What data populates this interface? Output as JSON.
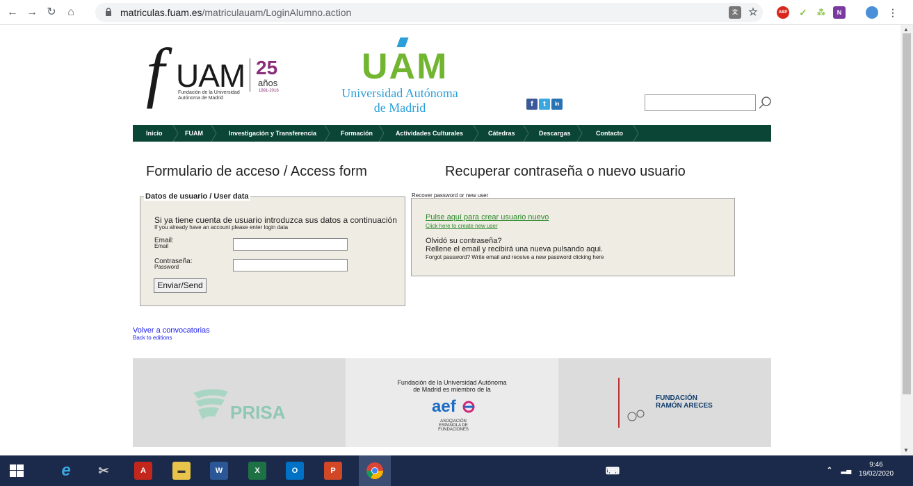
{
  "browser": {
    "url_host": "matriculas.fuam.es",
    "url_path": "/matriculauam/LoginAlumno.action",
    "back_icon": "arrow-left-icon",
    "forward_icon": "arrow-right-icon",
    "reload_icon": "reload-icon",
    "home_icon": "home-icon"
  },
  "header": {
    "fuam_letter": "f",
    "fuam_name": "UAM",
    "fuam_subtitle": "Fundación de la Universidad Autónoma de Madrid",
    "anniversary_number": "25",
    "anniversary_word": "años",
    "anniversary_years": "1991-2016",
    "uam_acronym": "UAM",
    "uam_name_line1": "Universidad Autónoma",
    "uam_name_line2": "de Madrid",
    "social": [
      "f",
      "t",
      "in"
    ]
  },
  "nav": {
    "items": [
      "Inicio",
      "FUAM",
      "Investigación y Transferencia",
      "Formación",
      "Actividades Culturales",
      "Cátedras",
      "Descargas",
      "Contacto"
    ]
  },
  "login": {
    "heading": "Formulario de acceso / Access form",
    "legend": "Datos de usuario / User data",
    "intro": "Si ya tiene cuenta de usuario introduzca sus datos a continuación",
    "intro_en": "If you already have an account please enter login data",
    "email_label": "Email:",
    "email_label_en": "Email",
    "email_value": "",
    "password_label": "Contraseña:",
    "password_label_en": "Password",
    "password_value": "",
    "submit_label": "Enviar/Send"
  },
  "recover": {
    "heading": "Recuperar contraseña o nuevo usuario",
    "subtitle_en": "Recover password or new user",
    "new_user_link": "Pulse aquí para crear usuario nuevo",
    "new_user_link_en": "Click here to create new user",
    "forgot_line1": "Olvidó su contraseña?",
    "forgot_line2": "Rellene el email y recibirá una nueva pulsando aqui.",
    "forgot_line3": "Forgot password? Write email and receive a new password clicking here"
  },
  "back": {
    "label": "Volver a convocatorias",
    "label_en": "Back to editions"
  },
  "sponsors": {
    "prisa": "PRISA",
    "aef_text_line1": "Fundación de la Universidad Autónoma",
    "aef_text_line2": "de Madrid es miembro de la",
    "aef_logo": "aef",
    "aef_sub": "ASOCIACIÓN ESPAÑOLA DE FUNDACIONES",
    "areces_line1": "FUNDACIÓN",
    "areces_line2": "RAMÓN ARECES"
  },
  "taskbar": {
    "time": "9:46",
    "date": "19/02/2020"
  },
  "colors": {
    "nav_bg": "#0b4535",
    "form_bg": "#efece3",
    "uam_green": "#72b530",
    "uam_blue": "#2a9fd8",
    "fuam_purple": "#8a2f7b",
    "link_green": "#2c8a2c",
    "link_blue": "#1a1aee"
  }
}
